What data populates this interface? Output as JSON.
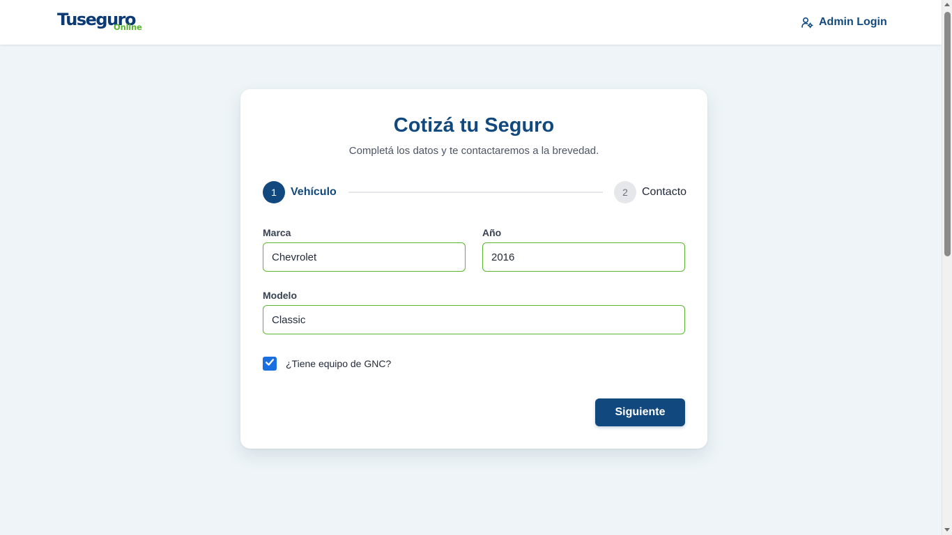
{
  "header": {
    "logo": {
      "main": "Tuseguro",
      "sub": "Online"
    },
    "admin_login": "Admin Login"
  },
  "form": {
    "title": "Cotizá tu Seguro",
    "subtitle": "Completá los datos y te contactaremos a la brevedad.",
    "steps": [
      {
        "number": "1",
        "label": "Vehículo",
        "state": "active"
      },
      {
        "number": "2",
        "label": "Contacto",
        "state": "inactive"
      }
    ],
    "fields": {
      "marca": {
        "label": "Marca",
        "value": "Chevrolet"
      },
      "anio": {
        "label": "Año",
        "value": "2016"
      },
      "modelo": {
        "label": "Modelo",
        "value": "Classic"
      }
    },
    "gnc": {
      "label": "¿Tiene equipo de GNC?",
      "checked": true
    },
    "next_button": "Siguiente"
  },
  "colors": {
    "brand_blue": "#11497e",
    "brand_green": "#5ab52e",
    "checkbox_blue": "#1a6fe0",
    "background": "#eef4f7"
  },
  "icons": {
    "admin": "user-gear-icon",
    "check": "checkmark-icon"
  }
}
